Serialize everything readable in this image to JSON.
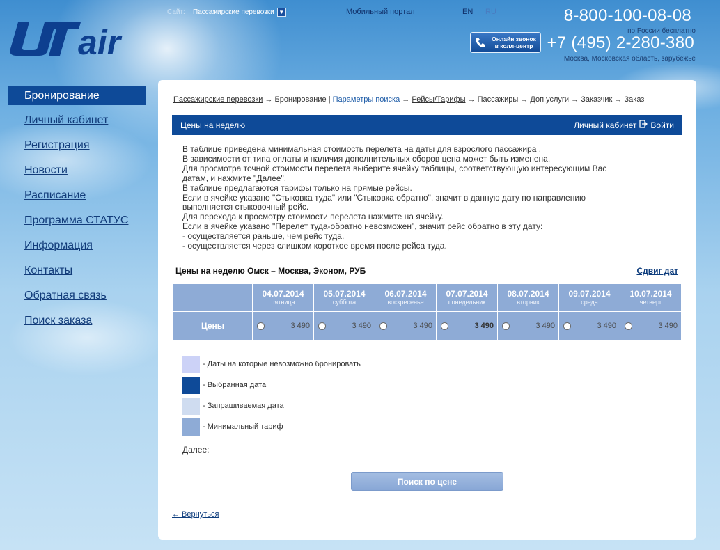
{
  "header": {
    "site_label": "Сайт:",
    "site_value": "Пассажирские перевозки",
    "mobile_portal": "Мобильный портал",
    "lang_en": "EN",
    "lang_ru": "RU",
    "phone_main": "8-800-100-08-08",
    "phone_main_note": "по России бесплатно",
    "phone_moscow": "+7 (495) 2-280-380",
    "phone_moscow_note": "Москва, Московская область, зарубежье",
    "callcenter_line1": "Онлайн звонок",
    "callcenter_line2": "в колл-центр"
  },
  "sidebar": {
    "items": [
      {
        "label": "Бронирование"
      },
      {
        "label": "Личный кабинет"
      },
      {
        "label": "Регистрация"
      },
      {
        "label": "Новости"
      },
      {
        "label": "Расписание"
      },
      {
        "label": "Программа СТАТУС"
      },
      {
        "label": "Информация"
      },
      {
        "label": "Контакты"
      },
      {
        "label": "Обратная связь"
      },
      {
        "label": "Поиск заказа"
      }
    ]
  },
  "breadcrumb": {
    "step1": "Пассажирские перевозки",
    "arrow": " → ",
    "step2": "Бронирование",
    "sep": " | ",
    "step3": "Параметры поиска",
    "step4": "Рейсы/Тарифы",
    "step5": "Пассажиры",
    "step6": "Доп.услуги",
    "step7": "Заказчик",
    "step8": "Заказ"
  },
  "titlebar": {
    "title": "Цены на неделю",
    "cabinet": "Личный кабинет",
    "logout": "Войти"
  },
  "info_lines": [
    "В таблице приведена минимальная стоимость перелета на даты для взрослого пассажира .",
    "В зависимости от типа оплаты и наличия дополнительных сборов цена может быть изменена.",
    "Для просмотра точной стоимости перелета выберите ячейку таблицы, соответствующую интересующим Вас",
    "датам, и нажмите \"Далее\".",
    "В таблице предлагаются тарифы только на прямые рейсы.",
    "Если в ячейке указано \"Стыковка туда\" или \"Стыковка обратно\", значит в данную дату по направлению",
    "выполняется стыковочный рейс.",
    "Для перехода к просмотру стоимости перелета нажмите на ячейку.",
    "Если в ячейке указано \"Перелет туда-обратно невозможен\", значит рейс обратно в эту дату:",
    "- осуществляется раньше, чем рейс туда,",
    "- осуществляется через слишком короткое время после рейса туда."
  ],
  "price_table": {
    "title": "Цены на неделю Омск – Москва, Эконом, РУБ",
    "shift_dates": "Сдвиг дат",
    "row_label": "Цены",
    "columns": [
      {
        "date": "04.07.2014",
        "dow": "пятница",
        "price": "3 490",
        "bold": false
      },
      {
        "date": "05.07.2014",
        "dow": "суббота",
        "price": "3 490",
        "bold": false
      },
      {
        "date": "06.07.2014",
        "dow": "воскресенье",
        "price": "3 490",
        "bold": false
      },
      {
        "date": "07.07.2014",
        "dow": "понедельник",
        "price": "3 490",
        "bold": true
      },
      {
        "date": "08.07.2014",
        "dow": "вторник",
        "price": "3 490",
        "bold": false
      },
      {
        "date": "09.07.2014",
        "dow": "среда",
        "price": "3 490",
        "bold": false
      },
      {
        "date": "10.07.2014",
        "dow": "четверг",
        "price": "3 490",
        "bold": false
      }
    ]
  },
  "legend": [
    {
      "label": "- Даты на которые невозможно бронировать",
      "color": "#ccd2f7"
    },
    {
      "label": "- Выбранная дата",
      "color": "#0e4a98"
    },
    {
      "label": "- Запрашиваемая дата",
      "color": "#cfdcf0"
    },
    {
      "label": "- Минимальный тариф",
      "color": "#8eabd6"
    }
  ],
  "next_label": "Далее:",
  "search_button": "Поиск по цене",
  "back_link": "← Вернуться",
  "colors": {
    "brand_blue": "#0e4a98",
    "table_cell": "#8eabd6",
    "link_blue": "#0e3d7d"
  }
}
